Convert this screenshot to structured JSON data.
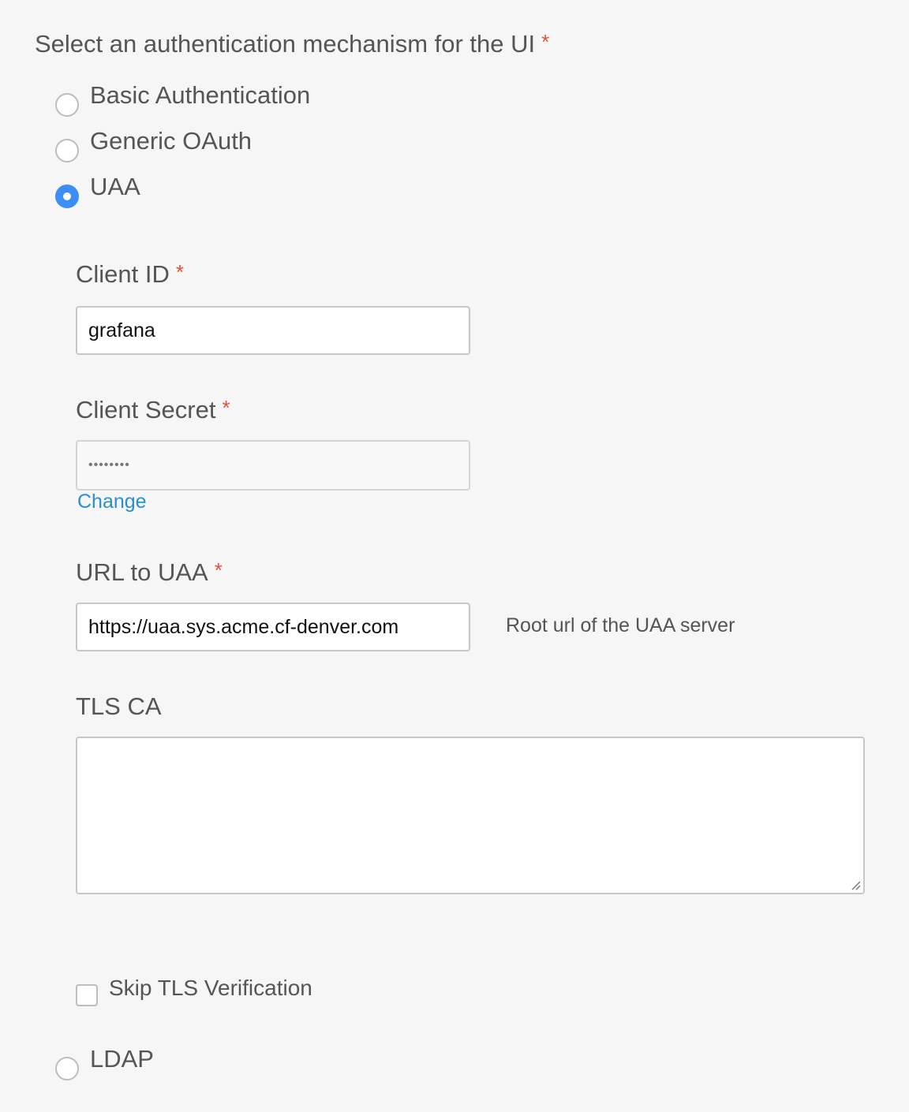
{
  "auth": {
    "question": "Select an authentication mechanism for the UI",
    "required_mark": "*",
    "options": [
      {
        "label": "Basic Authentication",
        "selected": false
      },
      {
        "label": "Generic OAuth",
        "selected": false
      },
      {
        "label": "UAA",
        "selected": true
      },
      {
        "label": "LDAP",
        "selected": false
      }
    ]
  },
  "uaa": {
    "client_id": {
      "label": "Client ID",
      "required_mark": "*",
      "value": "grafana"
    },
    "client_secret": {
      "label": "Client Secret",
      "required_mark": "*",
      "value": "••••••••",
      "change_link": "Change"
    },
    "url": {
      "label": "URL to UAA",
      "required_mark": "*",
      "value": "https://uaa.sys.acme.cf-denver.com",
      "hint": "Root url of the UAA server"
    },
    "tls_ca": {
      "label": "TLS CA",
      "value": ""
    },
    "skip_tls": {
      "label": "Skip TLS Verification",
      "checked": false
    }
  },
  "colors": {
    "accent": "#3c8df4",
    "required": "#e0533c",
    "link": "#2a8fd0",
    "background": "#f6f6f6"
  }
}
